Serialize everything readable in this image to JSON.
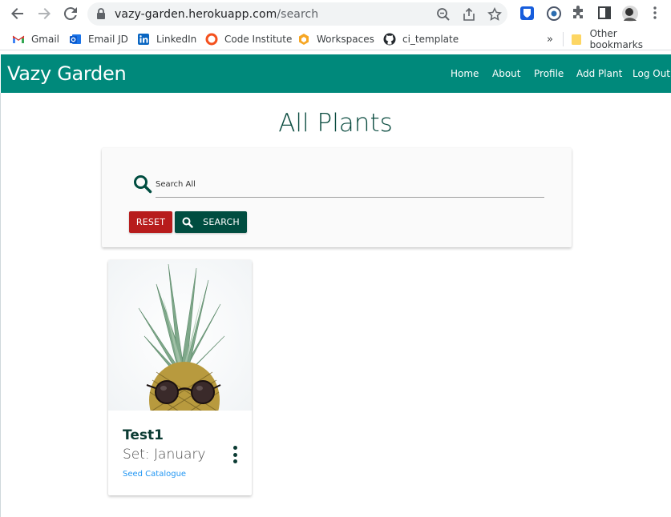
{
  "browser": {
    "url_host": "vazy-garden.herokuapp.com",
    "url_path": "/search",
    "bookmarks": [
      {
        "label": "Gmail",
        "icon": "gmail-icon"
      },
      {
        "label": "Email JD",
        "icon": "outlook-icon"
      },
      {
        "label": "LinkedIn",
        "icon": "linkedin-icon"
      },
      {
        "label": "Code Institute",
        "icon": "code-institute-icon"
      },
      {
        "label": "Workspaces",
        "icon": "workspaces-icon"
      },
      {
        "label": "ci_template",
        "icon": "github-icon"
      }
    ],
    "overflow_label": "»",
    "other_bookmarks": "Other bookmarks"
  },
  "site": {
    "brand": "Vazy Garden",
    "nav": [
      "Home",
      "About",
      "Profile",
      "Add Plant",
      "Log Out"
    ],
    "accent": "#00897b"
  },
  "page": {
    "title": "All Plants"
  },
  "search": {
    "placeholder": "Search All",
    "reset_label": "RESET",
    "search_label": "SEARCH",
    "reset_color": "#b71c1c",
    "search_color": "#004d40"
  },
  "cards": [
    {
      "title": "Test1",
      "subtitle": "Set: January",
      "link": "Seed Catalogue"
    }
  ]
}
